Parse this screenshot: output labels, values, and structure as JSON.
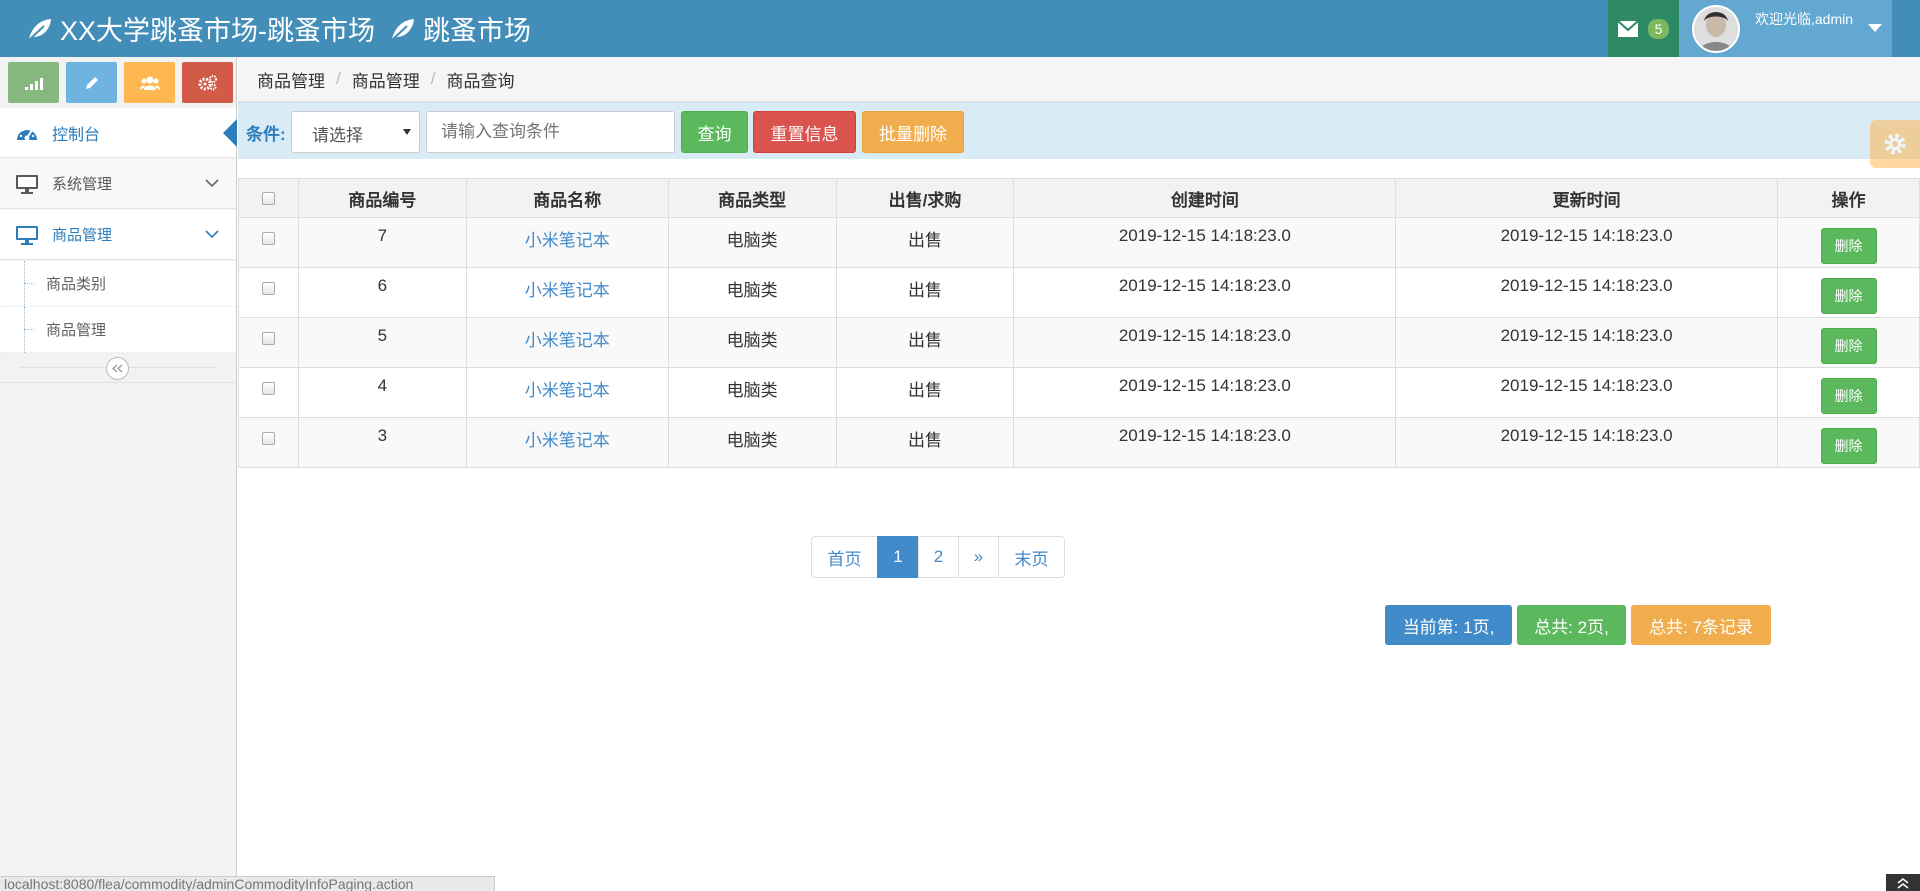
{
  "navbar": {
    "title": "XX大学跳蚤市场-跳蚤市场",
    "subtitle": "跳蚤市场",
    "message_count": "5",
    "welcome": "欢迎光临,admin"
  },
  "sidebar": {
    "shortcuts": [
      {
        "icon": "signal-icon",
        "color": "#87b87f"
      },
      {
        "icon": "pencil-icon",
        "color": "#6fb3e0"
      },
      {
        "icon": "users-icon",
        "color": "#ffb752"
      },
      {
        "icon": "cogs-icon",
        "color": "#d15b47"
      }
    ],
    "dashboard": "控制台",
    "system": "系统管理",
    "goods": "商品管理",
    "sub_items": [
      "商品类别",
      "商品管理"
    ]
  },
  "breadcrumbs": [
    "商品管理",
    "商品管理",
    "商品查询"
  ],
  "search": {
    "label": "条件:",
    "select_value": "请选择",
    "placeholder": "请输入查询条件",
    "query_label": "查询",
    "reset_label": "重置信息",
    "batch_delete_label": "批量删除"
  },
  "table": {
    "headers": [
      "商品编号",
      "商品名称",
      "商品类型",
      "出售/求购",
      "创建时间",
      "更新时间",
      "操作"
    ],
    "rows": [
      {
        "id": "7",
        "name": "小米笔记本",
        "type": "电脑类",
        "mode": "出售",
        "created": "2019-12-15 14:18:23.0",
        "updated": "2019-12-15 14:18:23.0",
        "action": "删除"
      },
      {
        "id": "6",
        "name": "小米笔记本",
        "type": "电脑类",
        "mode": "出售",
        "created": "2019-12-15 14:18:23.0",
        "updated": "2019-12-15 14:18:23.0",
        "action": "删除"
      },
      {
        "id": "5",
        "name": "小米笔记本",
        "type": "电脑类",
        "mode": "出售",
        "created": "2019-12-15 14:18:23.0",
        "updated": "2019-12-15 14:18:23.0",
        "action": "删除"
      },
      {
        "id": "4",
        "name": "小米笔记本",
        "type": "电脑类",
        "mode": "出售",
        "created": "2019-12-15 14:18:23.0",
        "updated": "2019-12-15 14:18:23.0",
        "action": "删除"
      },
      {
        "id": "3",
        "name": "小米笔记本",
        "type": "电脑类",
        "mode": "出售",
        "created": "2019-12-15 14:18:23.0",
        "updated": "2019-12-15 14:18:23.0",
        "action": "删除"
      }
    ]
  },
  "pagination": {
    "first": "首页",
    "pages": [
      "1",
      "2"
    ],
    "next": "»",
    "last": "末页"
  },
  "info": {
    "current": "当前第: 1页,",
    "total_pages": "总共: 2页,",
    "total_records": "总共: 7条记录"
  },
  "statusbar": {
    "url": "localhost:8080/flea/commodity/adminCommodityInfoPaging.action"
  }
}
